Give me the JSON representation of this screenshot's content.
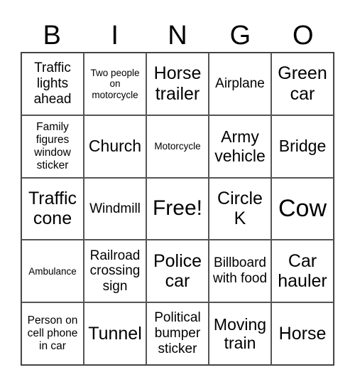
{
  "header": {
    "letters": [
      "B",
      "I",
      "N",
      "G",
      "O"
    ]
  },
  "cells": [
    "Traffic lights ahead",
    "Two people on motorcycle",
    "Horse trailer",
    "Airplane",
    "Green car",
    "Family figures window sticker",
    "Church",
    "Motorcycle",
    "Army vehicle",
    "Bridge",
    "Traffic cone",
    "Windmill",
    "Free!",
    "Circle K",
    "Cow",
    "Ambulance",
    "Railroad crossing sign",
    "Police car",
    "Billboard with food",
    "Car hauler",
    "Person on cell phone in car",
    "Tunnel",
    "Political bumper sticker",
    "Moving train",
    "Horse"
  ]
}
